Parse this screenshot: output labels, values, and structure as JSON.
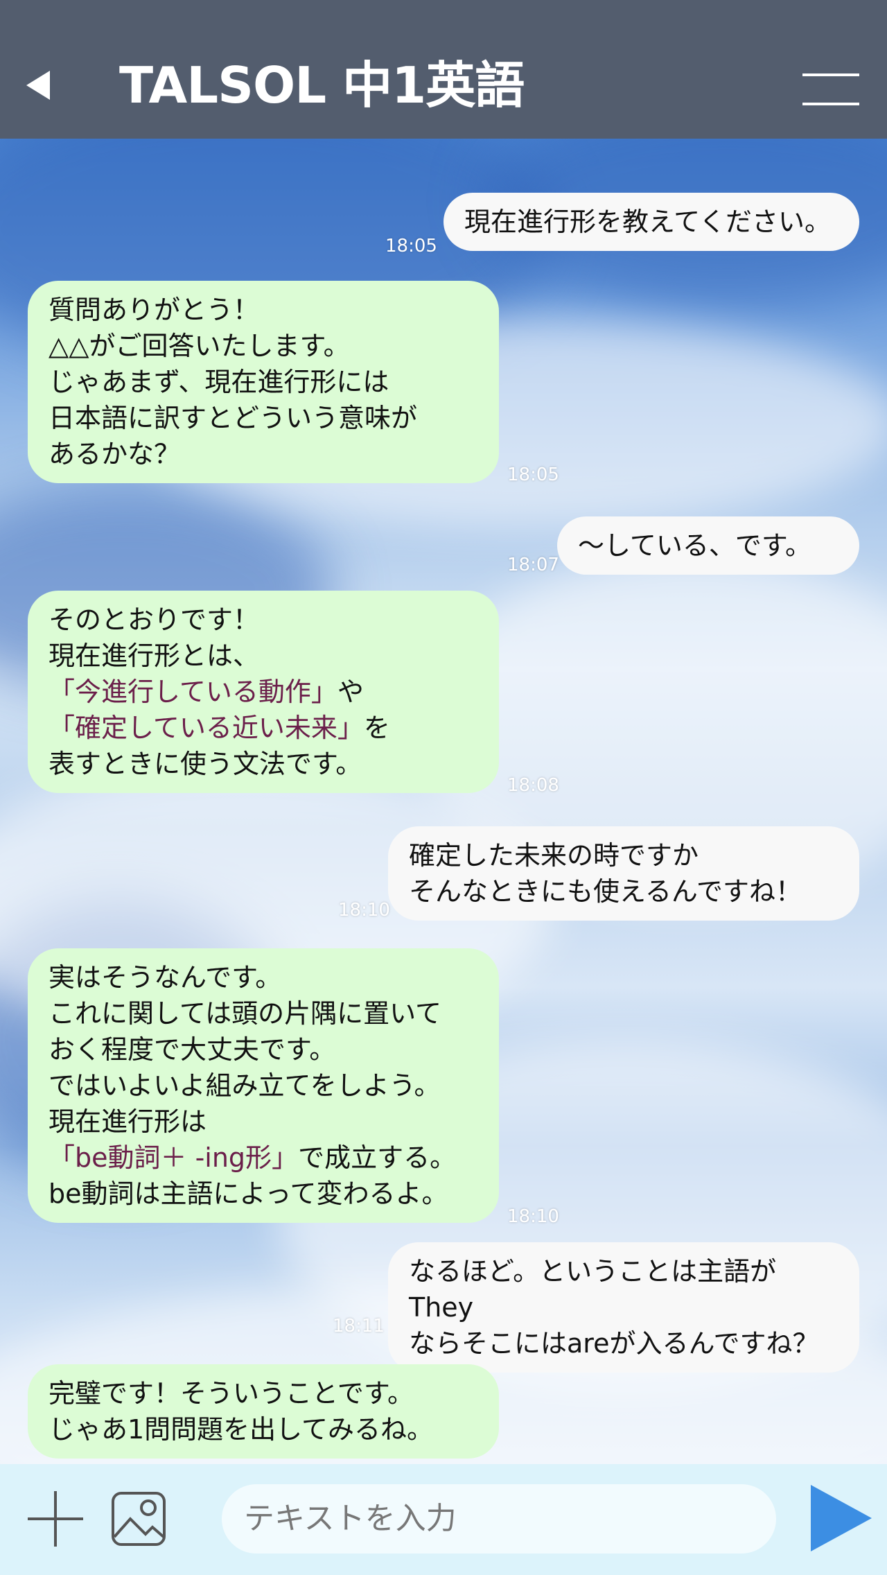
{
  "header": {
    "title": "TALSOL 中1英語",
    "back_icon": "back-arrow-icon",
    "menu_icon": "hamburger-menu-icon",
    "bg_color": "#535d6e"
  },
  "messages": [
    {
      "side": "user",
      "time": "18:05",
      "lines": [
        [
          {
            "t": "現在進行形を教えてください。"
          }
        ]
      ]
    },
    {
      "side": "bot",
      "time": "18:05",
      "lines": [
        [
          {
            "t": "質問ありがとう！"
          }
        ],
        [
          {
            "t": "△△がご回答いたします。"
          }
        ],
        [
          {
            "t": "じゃあまず、現在進行形には"
          }
        ],
        [
          {
            "t": "日本語に訳すとどういう意味が"
          }
        ],
        [
          {
            "t": "あるかな？"
          }
        ]
      ]
    },
    {
      "side": "user",
      "time": "18:07",
      "lines": [
        [
          {
            "t": "～している、です。"
          }
        ]
      ]
    },
    {
      "side": "bot",
      "time": "18:08",
      "lines": [
        [
          {
            "t": "そのとおりです！"
          }
        ],
        [
          {
            "t": "現在進行形とは、"
          }
        ],
        [
          {
            "t": "「今進行している動作」",
            "hl": true
          },
          {
            "t": "や"
          }
        ],
        [
          {
            "t": "「確定している近い未来」",
            "hl": true
          },
          {
            "t": "を"
          }
        ],
        [
          {
            "t": "表すときに使う文法です。"
          }
        ]
      ]
    },
    {
      "side": "user",
      "time": "18:10",
      "lines": [
        [
          {
            "t": "確定した未来の時ですか"
          }
        ],
        [
          {
            "t": "そんなときにも使えるんですね！"
          }
        ]
      ]
    },
    {
      "side": "bot",
      "time": "18:10",
      "lines": [
        [
          {
            "t": "実はそうなんです。"
          }
        ],
        [
          {
            "t": "これに関しては頭の片隅に置いて"
          }
        ],
        [
          {
            "t": "おく程度で大丈夫です。"
          }
        ],
        [
          {
            "t": "ではいよいよ組み立てをしよう。"
          }
        ],
        [
          {
            "t": "現在進行形は"
          }
        ],
        [
          {
            "t": "「be動詞＋ -ing形」",
            "hl": true
          },
          {
            "t": "で成立する。"
          }
        ],
        [
          {
            "t": "be動詞は主語によって変わるよ。"
          }
        ]
      ]
    },
    {
      "side": "user",
      "time": "18:11",
      "lines": [
        [
          {
            "t": "なるほど。ということは主語がThey"
          }
        ],
        [
          {
            "t": "ならそこにはareが入るんですね？"
          }
        ]
      ]
    },
    {
      "side": "bot",
      "time": "",
      "lines": [
        [
          {
            "t": "完璧です！そういうことです。"
          }
        ],
        [
          {
            "t": "じゃあ1問問題を出してみるね。"
          }
        ]
      ]
    }
  ],
  "input": {
    "placeholder": "テキストを入力"
  },
  "toolbar": {
    "plus_icon": "plus-icon",
    "image_icon": "image-icon",
    "send_icon": "send-icon"
  },
  "colors": {
    "bot_bubble": "#dcfcd5",
    "user_bubble": "#f8f8f8",
    "highlight": "#6b1f4a",
    "send": "#3c8ee3"
  }
}
